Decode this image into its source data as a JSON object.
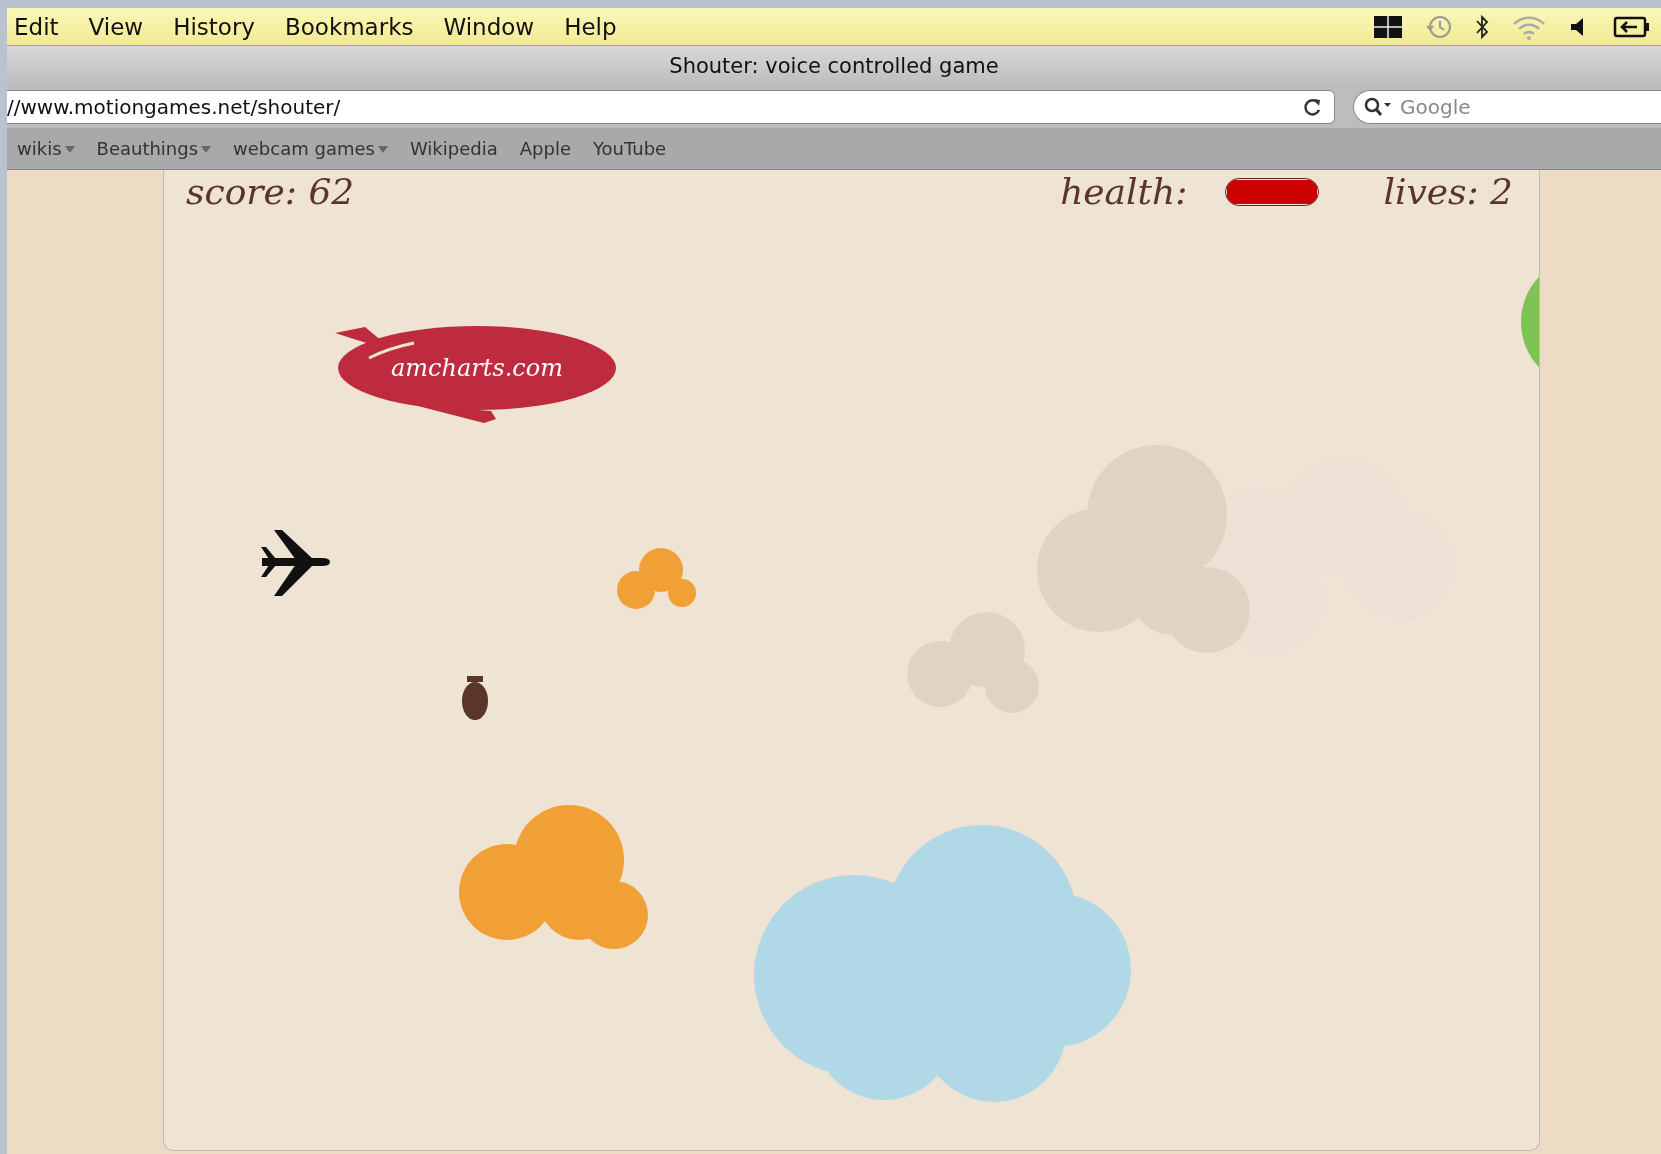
{
  "menu_bar": {
    "items": [
      "Edit",
      "View",
      "History",
      "Bookmarks",
      "Window",
      "Help"
    ]
  },
  "window": {
    "title": "Shouter: voice controlled game"
  },
  "address_bar": {
    "value": "//www.motiongames.net/shouter/"
  },
  "search_field": {
    "placeholder": "Google"
  },
  "bookmarks": [
    {
      "label": "wikis",
      "kind": "folder"
    },
    {
      "label": "Beauthings",
      "kind": "folder"
    },
    {
      "label": "webcam games",
      "kind": "folder"
    },
    {
      "label": "Wikipedia",
      "kind": "link"
    },
    {
      "label": "Apple",
      "kind": "link"
    },
    {
      "label": "YouTube",
      "kind": "link"
    }
  ],
  "game": {
    "score": "score: 62",
    "health_label": "health:",
    "health": {
      "level": 1
    },
    "lives": "lives: 2",
    "blimp_label": "amcharts.com"
  }
}
